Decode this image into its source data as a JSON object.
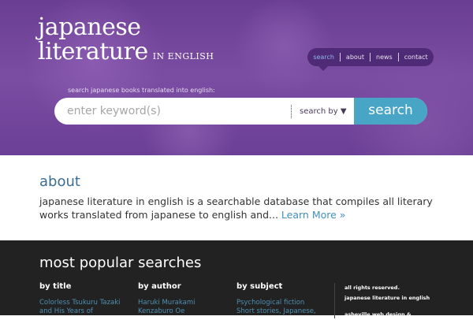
{
  "logo": {
    "line1": "japanese",
    "line2": "literature",
    "line3": "IN ENGLISH"
  },
  "nav": [
    {
      "label": "search"
    },
    {
      "label": "about"
    },
    {
      "label": "news"
    },
    {
      "label": "contact"
    }
  ],
  "search": {
    "tagline": "search japanese books translated into english:",
    "placeholder": "enter keyword(s)",
    "search_by": "search by ▼",
    "button": "search"
  },
  "about": {
    "title": "about",
    "text": "japanese literature in english is a searchable database that compiles all literary works translated from japanese to english and... ",
    "link": "Learn More »"
  },
  "footer": {
    "title": "most popular searches",
    "columns": [
      {
        "heading": "by title",
        "items": [
          "Colorless Tsukuru Tazaki",
          "and His Years of"
        ]
      },
      {
        "heading": "by author",
        "items": [
          "Haruki Murakami",
          "Kenzaburo Oe"
        ]
      },
      {
        "heading": "by subject",
        "items": [
          "Psychological fiction",
          "Short stories, Japanese,"
        ]
      }
    ],
    "legal": [
      "all rights reserved.",
      "japanese literature in english",
      "",
      "asheville web design &"
    ]
  }
}
